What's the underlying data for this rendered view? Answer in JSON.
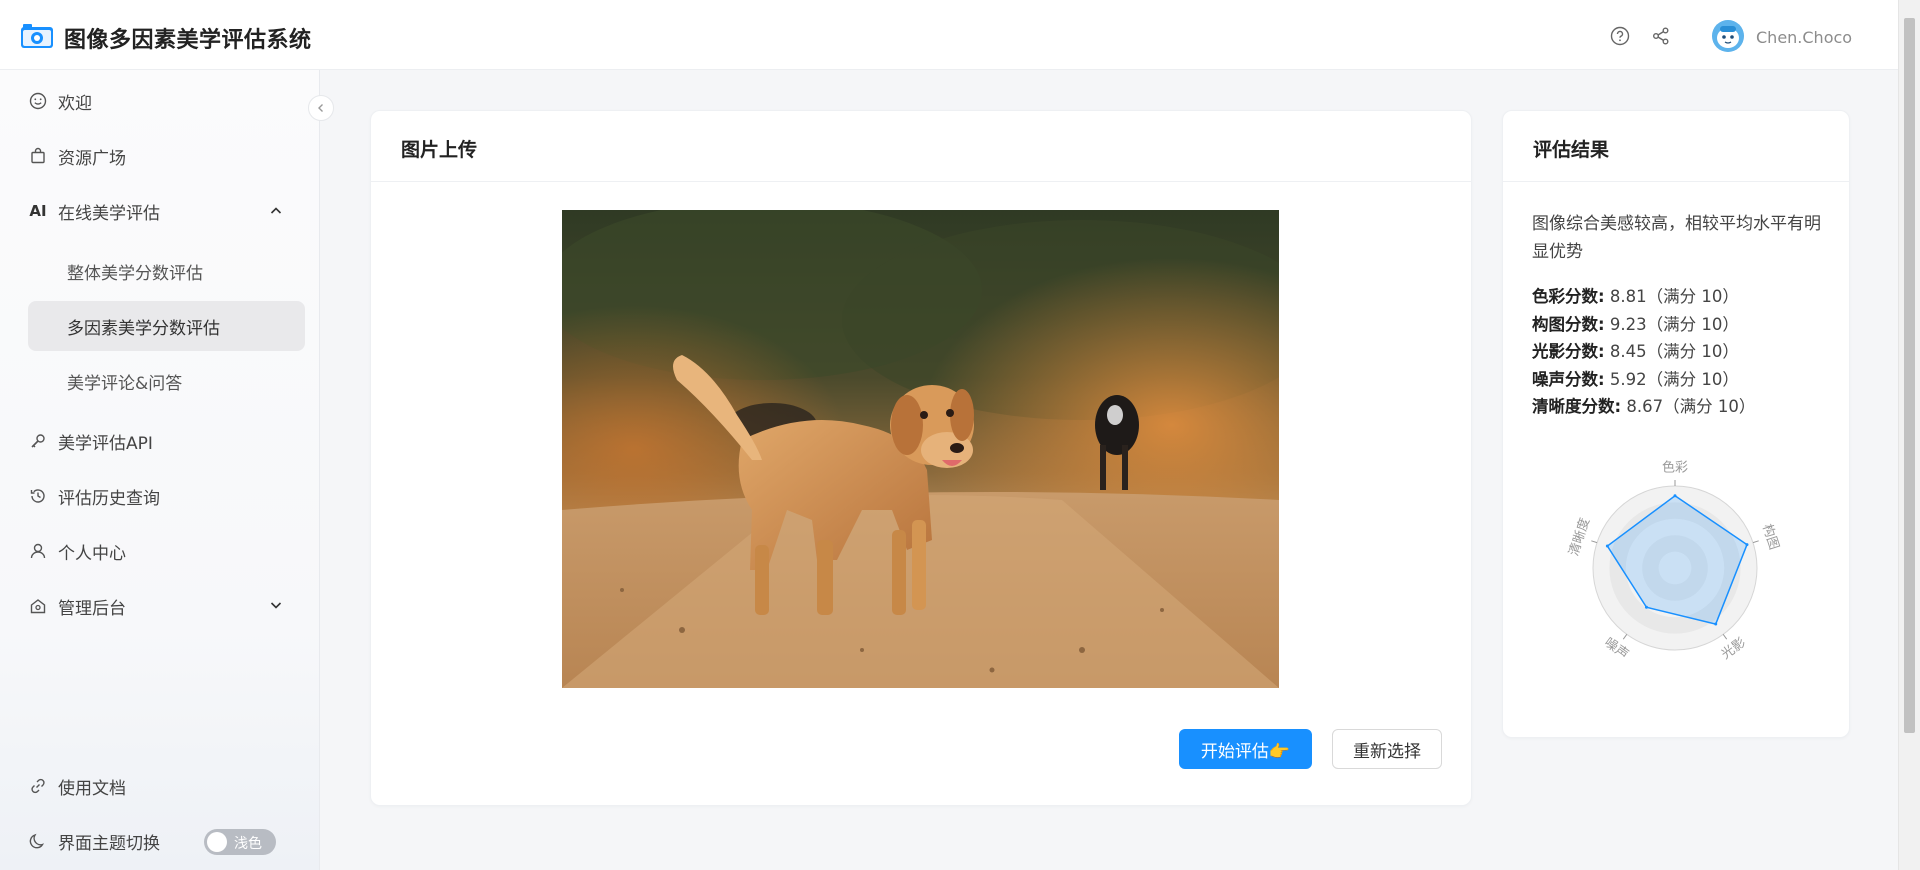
{
  "header": {
    "app_title": "图像多因素美学评估系统",
    "help_icon": "help-circle-icon",
    "share_icon": "share-icon",
    "username": "Chen.Choco"
  },
  "sidebar": {
    "items": [
      {
        "label": "欢迎",
        "icon": "smile-icon"
      },
      {
        "label": "资源广场",
        "icon": "shopping-bag-icon"
      },
      {
        "label": "在线美学评估",
        "icon": "ai-icon",
        "expanded": true,
        "children": [
          {
            "label": "整体美学分数评估"
          },
          {
            "label": "多因素美学分数评估",
            "active": true
          },
          {
            "label": "美学评论&问答"
          }
        ]
      },
      {
        "label": "美学评估API",
        "icon": "key-icon"
      },
      {
        "label": "评估历史查询",
        "icon": "history-icon"
      },
      {
        "label": "个人中心",
        "icon": "user-icon"
      },
      {
        "label": "管理后台",
        "icon": "admin-icon",
        "expanded": false
      }
    ],
    "ai_glyph": "AI",
    "footer": {
      "docs_label": "使用文档",
      "theme_label": "界面主题切换",
      "theme_toggle_label": "浅色"
    }
  },
  "upload_card": {
    "title": "图片上传",
    "start_button": "开始评估👉",
    "reselect_button": "重新选择"
  },
  "result_card": {
    "title": "评估结果",
    "summary": "图像综合美感较高，相较平均水平有明显优势",
    "scores": [
      {
        "label": "色彩分数:",
        "value": "8.81（满分 10）"
      },
      {
        "label": "构图分数:",
        "value": "9.23（满分 10）"
      },
      {
        "label": "光影分数:",
        "value": "8.45（满分 10）"
      },
      {
        "label": "噪声分数:",
        "value": "5.92（满分 10）"
      },
      {
        "label": "清晰度分数:",
        "value": "8.67（满分 10）"
      }
    ]
  },
  "chart_data": {
    "type": "radar",
    "categories": [
      "色彩",
      "构图",
      "光影",
      "噪声",
      "清晰度"
    ],
    "values": [
      8.81,
      9.23,
      8.45,
      5.92,
      8.67
    ],
    "max": 10,
    "color": "#1890ff"
  },
  "colors": {
    "accent": "#1890ff",
    "active_menu_bg": "#e9e9eb"
  }
}
